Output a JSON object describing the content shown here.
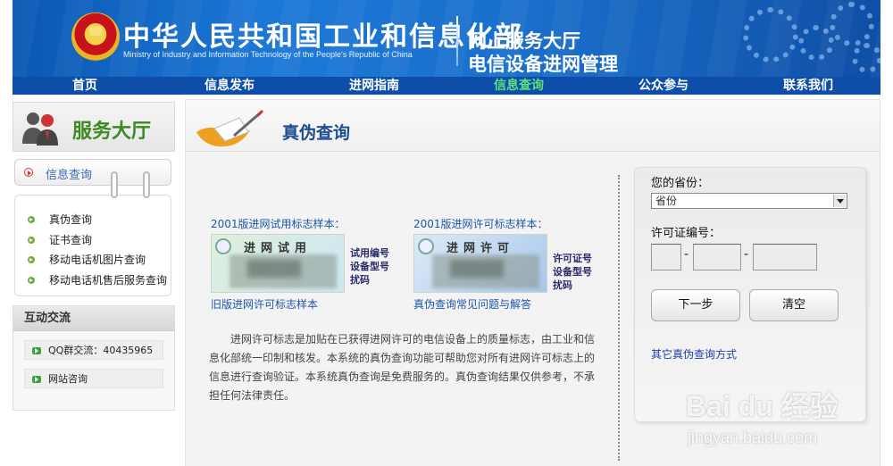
{
  "header": {
    "ministry_cn": "中华人民共和国工业和信息化部",
    "ministry_en": "Ministry of Industry and Information Technology of the People's Republic of China",
    "hall_title": "网上服务大厅",
    "hall_subtitle": "电信设备进网管理"
  },
  "nav": {
    "items": [
      "首页",
      "信息发布",
      "进网指南",
      "信息查询",
      "公众参与",
      "联系我们"
    ],
    "active": "信息查询"
  },
  "sidebar": {
    "service_title": "服务大厅",
    "query_heading": "信息查询",
    "items": [
      "真伪查询",
      "证书查询",
      "移动电话机图片查询",
      "移动电话机售后服务查询"
    ],
    "interact_title": "互动交流",
    "interact_items": [
      "QQ群交流：40435965",
      "网站咨询"
    ]
  },
  "main": {
    "title": "真伪查询",
    "sample1_caption": "2001版进网试用标志样本：",
    "sample1_head": "进网试用",
    "sample1_labels": [
      "试用编号",
      "设备型号",
      "扰码"
    ],
    "sample1_link": "旧版进网许可标志样本",
    "sample2_caption": "2001版进网许可标志样本：",
    "sample2_head": "进网许可",
    "sample2_labels": [
      "许可证号",
      "设备型号",
      "扰码"
    ],
    "sample2_link": "真伪查询常见问题与解答",
    "description": "进网许可标志是加贴在已获得进网许可的电信设备上的质量标志，由工业和信息化部统一印制和核发。本系统的真伪查询功能可帮助您对所有进网许可标志上的信息进行查询验证。本系统真伪查询是免费服务的。真伪查询结果仅供参考，不承担任何法律责任。"
  },
  "form": {
    "province_label": "您的省份：",
    "province_value": "省份",
    "license_label": "许可证编号：",
    "license_part1": "",
    "license_part2": "",
    "license_part3": "",
    "next_button": "下一步",
    "clear_button": "清空",
    "other_link": "其它真伪查询方式"
  },
  "watermark": {
    "brand": "Bai du 经验",
    "url": "jingyan.baidu.com"
  },
  "colors": {
    "banner": "#1a6fcb",
    "nav": "#0c4ea8",
    "nav_active": "#5fe07a",
    "service_green": "#3b8a22",
    "link_blue": "#1a57a8",
    "title_blue": "#1e4c8f"
  }
}
